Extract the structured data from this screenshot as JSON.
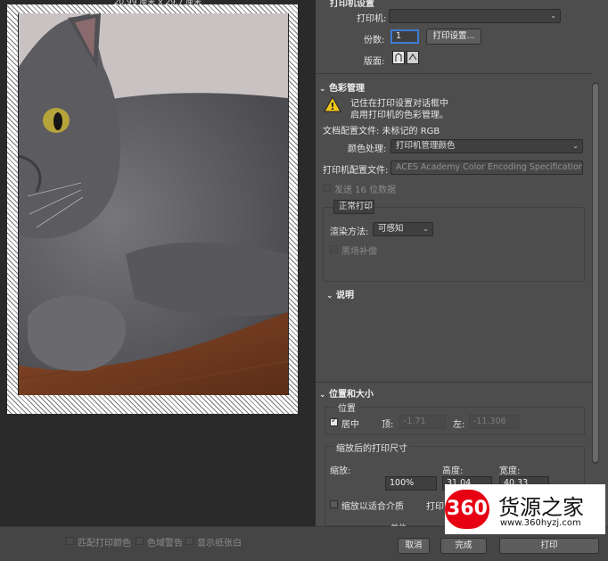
{
  "preview": {
    "page_size": "20.99 厘米 x 29.7 厘米"
  },
  "printer_setup": {
    "section_title": "打印机设置",
    "printer_label": "打印机:",
    "printer_value": "",
    "copies_label": "份数:",
    "copies_value": "1",
    "print_settings_button": "打印设置...",
    "layout_label": "版面:"
  },
  "color_management": {
    "title": "色彩管理",
    "warning_line1": "记住在打印设置对话框中",
    "warning_line2": "启用打印机的色彩管理。",
    "document_profile": "文档配置文件: 未标记的 RGB",
    "color_handling_label": "颜色处理:",
    "color_handling_value": "打印机管理颜色",
    "printer_profile_label": "打印机配置文件:",
    "printer_profile_value": "ACES Academy Color Encoding Specification...",
    "send_16bit_label": "发送 16 位数据",
    "normal_print_value": "正常打印",
    "rendering_intent_label": "渲染方法:",
    "rendering_intent_value": "可感知",
    "black_point_label": "黑场补偿"
  },
  "description": {
    "title": "说明"
  },
  "position_size": {
    "title": "位置和大小",
    "position_title": "位置",
    "center_label": "居中",
    "top_label": "顶:",
    "top_value": "-1.71",
    "left_label": "左:",
    "left_value": "-11.306",
    "scaled_title": "缩放后的打印尺寸",
    "scale_label": "缩放:",
    "height_label": "高度:",
    "width_label": "宽度:",
    "scale_value": "100%",
    "height_value": "31.04",
    "width_value": "40.33",
    "fit_media_label": "缩放以适合介质",
    "print_resolution_label": "打印分",
    "unit_label": "单位:"
  },
  "bottom": {
    "match_colors": "匹配打印颜色",
    "gamut_warning": "色域警告",
    "show_paper_white": "显示纸张白",
    "cancel": "取消",
    "done": "完成",
    "print": "打印"
  },
  "watermark": {
    "logo_text": "360",
    "title": "货源之家",
    "url": "www.360hyzj.com"
  }
}
